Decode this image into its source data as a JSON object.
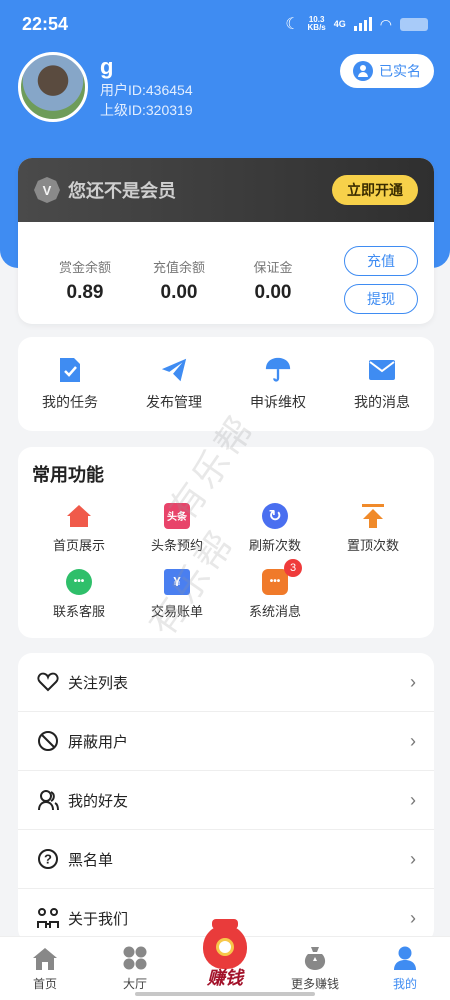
{
  "status": {
    "time": "22:54",
    "net_speed": "10.3",
    "net_unit": "KB/s",
    "network": "4G"
  },
  "profile": {
    "name": "g",
    "user_id": "用户ID:436454",
    "parent_id": "上级ID:320319",
    "verified_label": "已实名"
  },
  "vip": {
    "badge_letter": "V",
    "text": "您还不是会员",
    "open_label": "立即开通"
  },
  "balances": [
    {
      "label": "赏金余额",
      "value": "0.89"
    },
    {
      "label": "充值余额",
      "value": "0.00"
    },
    {
      "label": "保证金",
      "value": "0.00"
    }
  ],
  "balance_actions": {
    "recharge": "充值",
    "withdraw": "提现"
  },
  "quick_actions": [
    {
      "label": "我的任务",
      "icon": "task-icon"
    },
    {
      "label": "发布管理",
      "icon": "paper-plane-icon"
    },
    {
      "label": "申诉维权",
      "icon": "umbrella-icon"
    },
    {
      "label": "我的消息",
      "icon": "mail-icon"
    }
  ],
  "common": {
    "title": "常用功能",
    "items": [
      {
        "label": "首页展示",
        "icon": "house-icon"
      },
      {
        "label": "头条预约",
        "icon": "toutiao-icon",
        "icon_text": "头条"
      },
      {
        "label": "刷新次数",
        "icon": "refresh-icon"
      },
      {
        "label": "置顶次数",
        "icon": "pin-top-icon"
      },
      {
        "label": "联系客服",
        "icon": "chat-icon"
      },
      {
        "label": "交易账单",
        "icon": "bill-icon",
        "icon_text": "¥"
      },
      {
        "label": "系统消息",
        "icon": "system-message-icon",
        "badge": "3"
      }
    ]
  },
  "menu": [
    {
      "label": "关注列表",
      "icon": "heart-icon"
    },
    {
      "label": "屏蔽用户",
      "icon": "block-icon"
    },
    {
      "label": "我的好友",
      "icon": "friends-icon"
    },
    {
      "label": "黑名单",
      "icon": "question-icon"
    },
    {
      "label": "关于我们",
      "icon": "about-icon"
    }
  ],
  "watermark": "有乐帮",
  "tabbar": {
    "home": "首页",
    "hall": "大厅",
    "earn": "赚钱",
    "more_earn": "更多赚钱",
    "mine": "我的"
  },
  "colors": {
    "primary": "#3f8cf2",
    "vip_button": "#f7d14a",
    "badge": "#ef3b3b"
  }
}
